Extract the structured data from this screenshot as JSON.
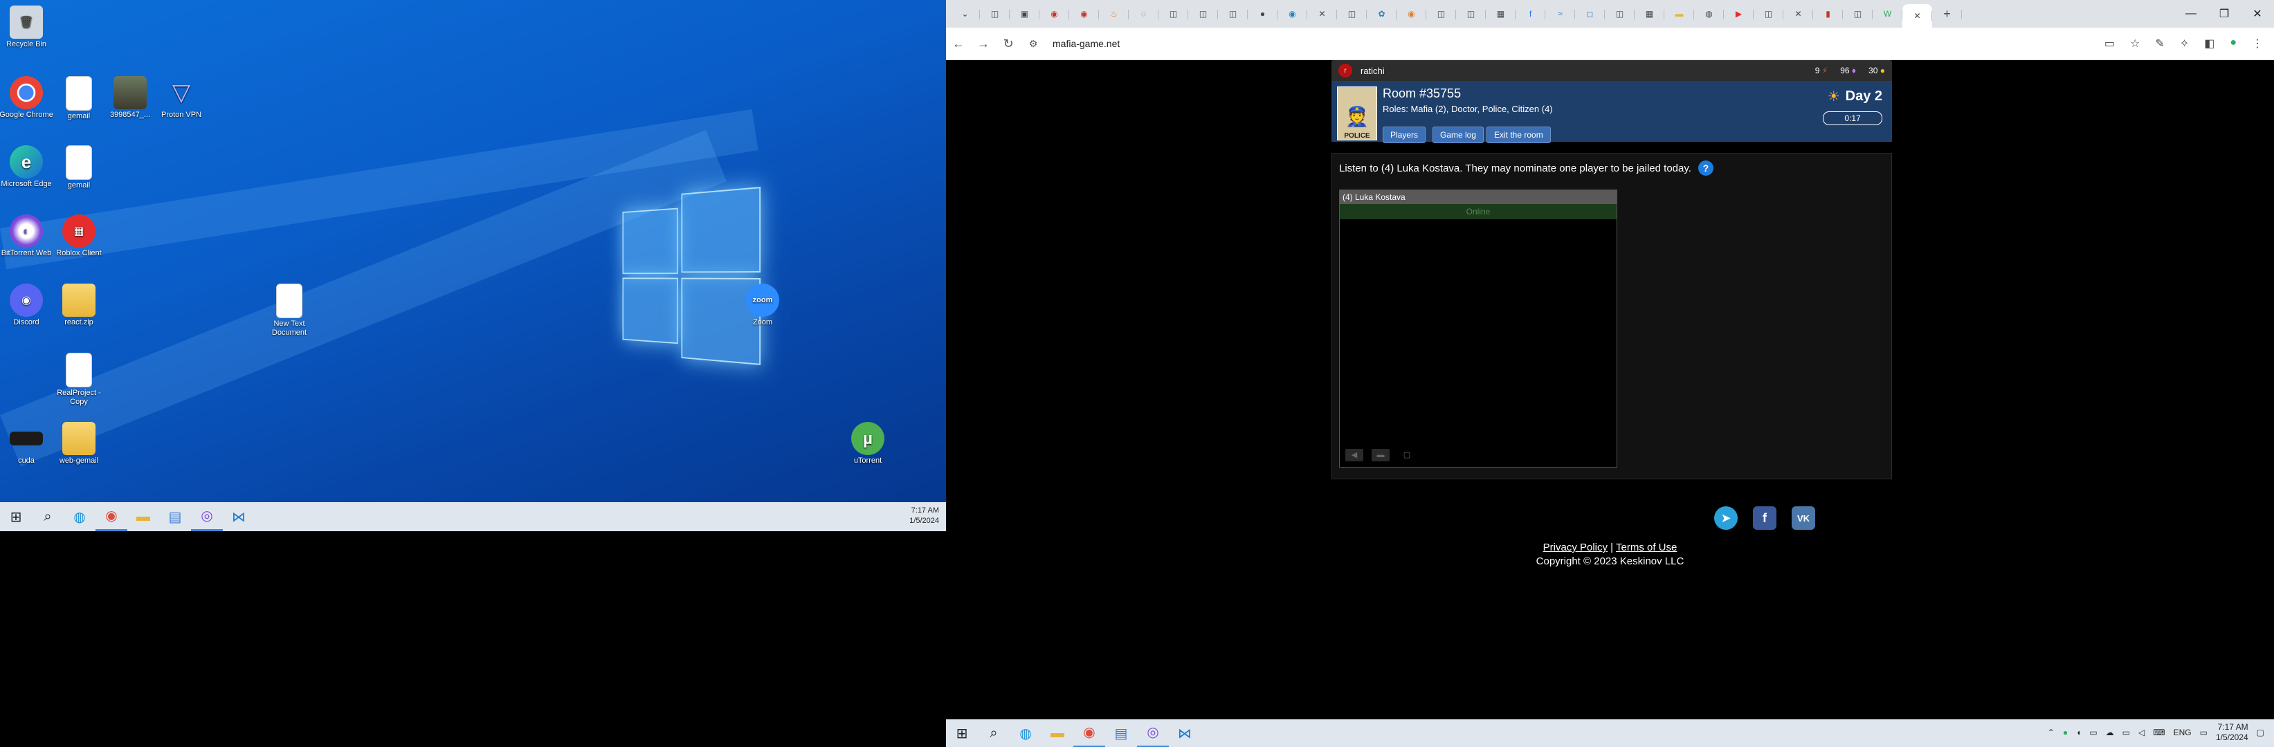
{
  "left_desktop": {
    "icons": [
      {
        "label": "Recycle Bin",
        "glyph": "🗑"
      },
      {
        "label": "Google Chrome",
        "glyph": "●"
      },
      {
        "label": "gemail",
        "glyph": ""
      },
      {
        "label": "3998547_...",
        "glyph": ""
      },
      {
        "label": "Proton VPN",
        "glyph": "▽"
      },
      {
        "label": "Microsoft Edge",
        "glyph": "e"
      },
      {
        "label": "gemail",
        "glyph": ""
      },
      {
        "label": "BitTorrent Web",
        "glyph": "◐"
      },
      {
        "label": "Roblox Client",
        "glyph": "▦"
      },
      {
        "label": "New Text Document",
        "glyph": ""
      },
      {
        "label": "Zoom",
        "glyph": "zoom"
      },
      {
        "label": "Discord",
        "glyph": "◉"
      },
      {
        "label": "react.zip",
        "glyph": ""
      },
      {
        "label": "RealProject - Copy",
        "glyph": ""
      },
      {
        "label": "uTorrent",
        "glyph": "µ"
      },
      {
        "label": "cuda",
        "glyph": ""
      },
      {
        "label": "web-gemail",
        "glyph": ""
      }
    ],
    "clock": {
      "time": "7:17 AM",
      "date": "1/5/2024"
    }
  },
  "browser": {
    "url": "mafia-game.net",
    "user": {
      "name": "ratichi",
      "initial": "r",
      "energy": "9",
      "gems": "96",
      "coins": "30"
    },
    "room": {
      "title": "Room #35755",
      "roles": "Roles: Mafia (2), Doctor, Police, Citizen (4)",
      "role_card": "POLICE",
      "day": "Day 2",
      "timer": "0:17",
      "buttons": [
        "Players",
        "Game log",
        "Exit the room"
      ]
    },
    "message": "Listen to (4) Luka Kostava. They may nominate one player to be jailed today.",
    "player": {
      "name": "(4) Luka Kostava",
      "status": "Online"
    },
    "footer": {
      "privacy": "Privacy Policy",
      "sep": "|",
      "terms": "Terms of Use",
      "copyright": "Copyright © 2023 Keskinov LLC"
    },
    "clock": {
      "time": "7:17 AM",
      "date": "1/5/2024"
    },
    "tray": {
      "lang": "ENG"
    }
  }
}
